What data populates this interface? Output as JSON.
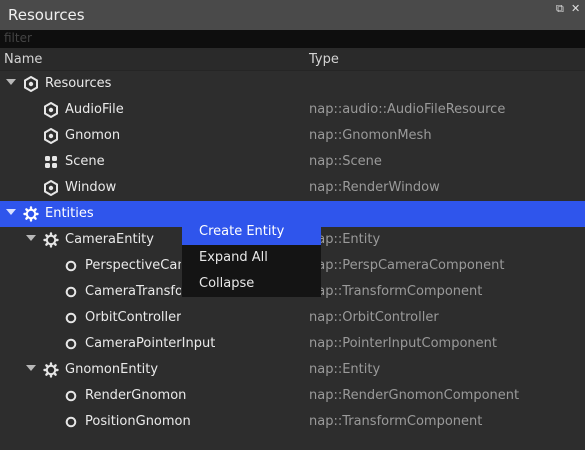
{
  "window": {
    "title": "Resources",
    "restore_glyph": "⧉",
    "close_glyph": "✕"
  },
  "filter": {
    "placeholder": "filter"
  },
  "columns": {
    "name": "Name",
    "type": "Type"
  },
  "rows": [
    {
      "label": "Resources",
      "type": "",
      "icon": "hexagon-nut-icon",
      "expanded": true
    },
    {
      "label": "AudioFile",
      "type": "nap::audio::AudioFileResource",
      "icon": "hexagon-nut-icon"
    },
    {
      "label": "Gnomon",
      "type": "nap::GnomonMesh",
      "icon": "hexagon-nut-icon"
    },
    {
      "label": "Scene",
      "type": "nap::Scene",
      "icon": "grid-dots-icon"
    },
    {
      "label": "Window",
      "type": "nap::RenderWindow",
      "icon": "hexagon-nut-icon"
    },
    {
      "label": "Entities",
      "type": "",
      "icon": "gear-icon",
      "expanded": true,
      "selected": true
    },
    {
      "label": "CameraEntity",
      "type": "nap::Entity",
      "icon": "gear-icon",
      "expanded": true
    },
    {
      "label": "PerspectiveCamera",
      "type": "nap::PerspCameraComponent",
      "icon": "circle-icon"
    },
    {
      "label": "CameraTransform",
      "type": "nap::TransformComponent",
      "icon": "circle-icon"
    },
    {
      "label": "OrbitController",
      "type": "nap::OrbitController",
      "icon": "circle-icon"
    },
    {
      "label": "CameraPointerInput",
      "type": "nap::PointerInputComponent",
      "icon": "circle-icon"
    },
    {
      "label": "GnomonEntity",
      "type": "nap::Entity",
      "icon": "gear-icon",
      "expanded": true
    },
    {
      "label": "RenderGnomon",
      "type": "nap::RenderGnomonComponent",
      "icon": "circle-icon"
    },
    {
      "label": "PositionGnomon",
      "type": "nap::TransformComponent",
      "icon": "circle-icon"
    }
  ],
  "context_menu": {
    "items": [
      {
        "label": "Create Entity",
        "highlighted": true
      },
      {
        "label": "Expand All"
      },
      {
        "label": "Collapse"
      }
    ]
  },
  "colors": {
    "selection": "#2f55ec",
    "background": "#2d2d2d",
    "menu_bg": "#141414"
  }
}
